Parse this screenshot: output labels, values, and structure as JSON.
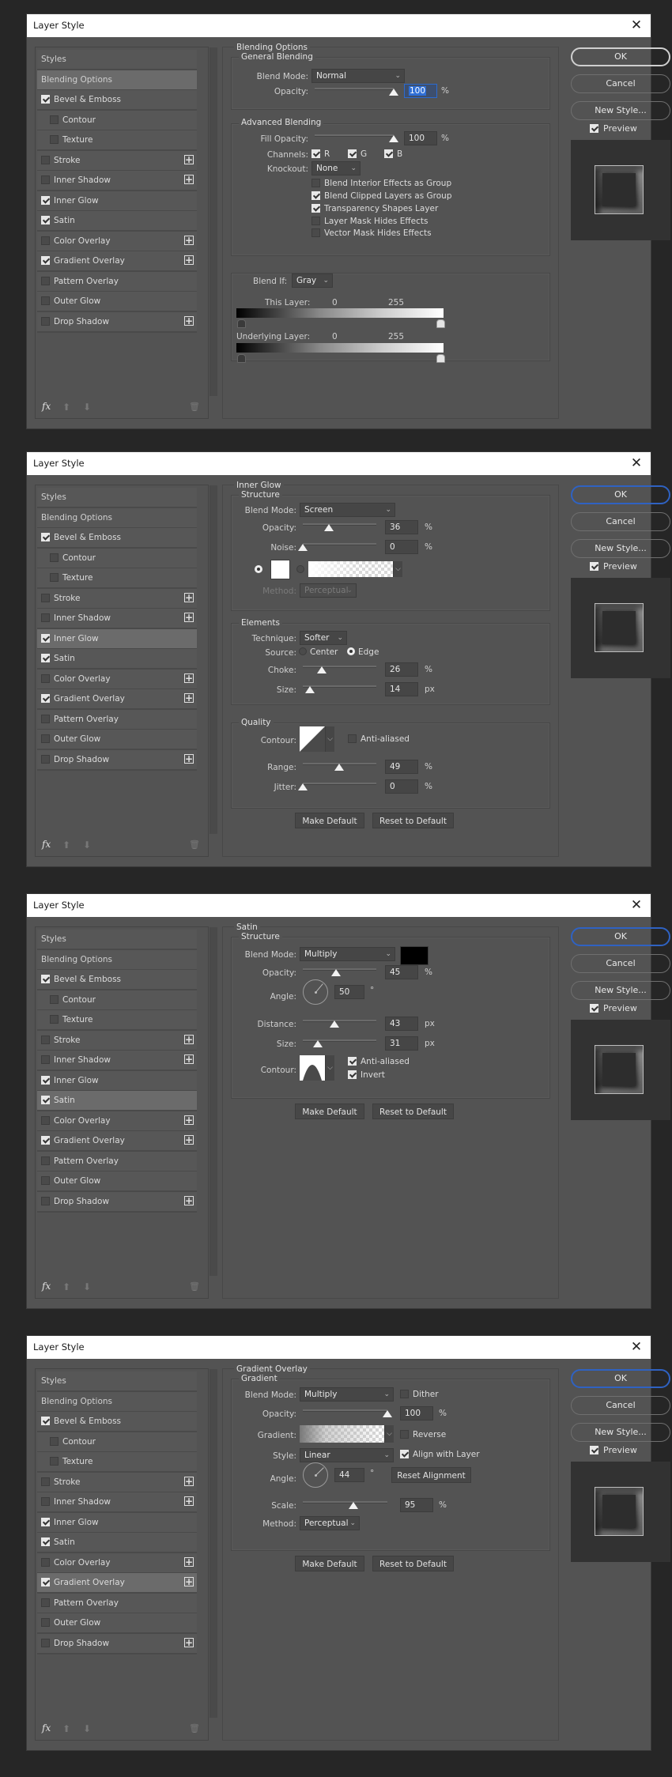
{
  "window_title": "Layer Style",
  "common": {
    "close_icon": "close-icon",
    "sidebar": {
      "styles_label": "Styles",
      "blending_options_label": "Blending Options",
      "items": [
        {
          "label": "Bevel & Emboss",
          "checked": true,
          "sub": false,
          "plus": false
        },
        {
          "label": "Contour",
          "checked": false,
          "sub": true,
          "plus": false
        },
        {
          "label": "Texture",
          "checked": false,
          "sub": true,
          "plus": false
        },
        {
          "label": "Stroke",
          "checked": false,
          "sub": false,
          "plus": true
        },
        {
          "label": "Inner Shadow",
          "checked": false,
          "sub": false,
          "plus": true
        },
        {
          "label": "Inner Glow",
          "checked": true,
          "sub": false,
          "plus": false
        },
        {
          "label": "Satin",
          "checked": true,
          "sub": false,
          "plus": false
        },
        {
          "label": "Color Overlay",
          "checked": false,
          "sub": false,
          "plus": true
        },
        {
          "label": "Gradient Overlay",
          "checked": true,
          "sub": false,
          "plus": true
        },
        {
          "label": "Pattern Overlay",
          "checked": false,
          "sub": false,
          "plus": false
        },
        {
          "label": "Outer Glow",
          "checked": false,
          "sub": false,
          "plus": false
        },
        {
          "label": "Drop Shadow",
          "checked": false,
          "sub": false,
          "plus": true
        }
      ],
      "footer": {
        "fx": "fx",
        "up_icon": "move-up-icon",
        "down_icon": "move-down-icon",
        "trash_icon": "trash-icon"
      }
    },
    "buttons": {
      "ok": "OK",
      "cancel": "Cancel",
      "new_style": "New Style...",
      "preview": "Preview",
      "preview_checked": true
    },
    "make_default": "Make Default",
    "reset_to_default": "Reset to Default"
  },
  "dialogs": [
    {
      "active_item": "Blending Options",
      "panel": {
        "title": "Blending Options",
        "general": {
          "title": "General Blending",
          "blend_mode_label": "Blend Mode:",
          "blend_mode": "Normal",
          "opacity_label": "Opacity:",
          "opacity": "100",
          "opacity_unit": "%",
          "opacity_fraction": 1.0
        },
        "advanced": {
          "title": "Advanced Blending",
          "fill_opacity_label": "Fill Opacity:",
          "fill_opacity": "100",
          "fill_unit": "%",
          "fill_fraction": 1.0,
          "channels_label": "Channels:",
          "channels": [
            {
              "label": "R",
              "checked": true
            },
            {
              "label": "G",
              "checked": true
            },
            {
              "label": "B",
              "checked": true
            }
          ],
          "knockout_label": "Knockout:",
          "knockout": "None",
          "options": [
            {
              "label": "Blend Interior Effects as Group",
              "checked": false
            },
            {
              "label": "Blend Clipped Layers as Group",
              "checked": true
            },
            {
              "label": "Transparency Shapes Layer",
              "checked": true
            },
            {
              "label": "Layer Mask Hides Effects",
              "checked": false
            },
            {
              "label": "Vector Mask Hides Effects",
              "checked": false
            }
          ]
        },
        "blend_if": {
          "label": "Blend If:",
          "value": "Gray",
          "this_layer_label": "This Layer:",
          "this_low": "0",
          "this_high": "255",
          "underlying_label": "Underlying Layer:",
          "under_low": "0",
          "under_high": "255"
        }
      }
    },
    {
      "active_item": "Inner Glow",
      "panel": {
        "title": "Inner Glow",
        "structure": {
          "title": "Structure",
          "blend_mode_label": "Blend Mode:",
          "blend_mode": "Screen",
          "opacity_label": "Opacity:",
          "opacity": "36",
          "opacity_unit": "%",
          "opacity_fraction": 0.36,
          "noise_label": "Noise:",
          "noise": "0",
          "noise_unit": "%",
          "noise_fraction": 0.0,
          "color_mode": "solid",
          "color": "#ffffff",
          "method_label": "Method:",
          "method": "Perceptual"
        },
        "elements": {
          "title": "Elements",
          "technique_label": "Technique:",
          "technique": "Softer",
          "source_label": "Source:",
          "source_center": "Center",
          "source_edge": "Edge",
          "source_selected": "Edge",
          "choke_label": "Choke:",
          "choke": "26",
          "choke_unit": "%",
          "choke_fraction": 0.26,
          "size_label": "Size:",
          "size": "14",
          "size_unit": "px",
          "size_fraction": 0.1
        },
        "quality": {
          "title": "Quality",
          "contour_label": "Contour:",
          "anti_aliased": "Anti-aliased",
          "anti_aliased_checked": false,
          "range_label": "Range:",
          "range": "49",
          "range_unit": "%",
          "range_fraction": 0.49,
          "jitter_label": "Jitter:",
          "jitter": "0",
          "jitter_unit": "%",
          "jitter_fraction": 0.0
        }
      }
    },
    {
      "active_item": "Satin",
      "panel": {
        "title": "Satin",
        "structure": {
          "title": "Structure",
          "blend_mode_label": "Blend Mode:",
          "blend_mode": "Multiply",
          "color": "#000000",
          "opacity_label": "Opacity:",
          "opacity": "45",
          "opacity_unit": "%",
          "opacity_fraction": 0.45,
          "angle_label": "Angle:",
          "angle": "50",
          "angle_unit": "°",
          "distance_label": "Distance:",
          "distance": "43",
          "distance_unit": "px",
          "distance_fraction": 0.43,
          "size_label": "Size:",
          "size": "31",
          "size_unit": "px",
          "size_fraction": 0.2,
          "contour_label": "Contour:",
          "anti_aliased": "Anti-aliased",
          "anti_aliased_checked": true,
          "invert": "Invert",
          "invert_checked": true
        }
      }
    },
    {
      "active_item": "Gradient Overlay",
      "panel": {
        "title": "Gradient Overlay",
        "gradient": {
          "title": "Gradient",
          "blend_mode_label": "Blend Mode:",
          "blend_mode": "Multiply",
          "dither": "Dither",
          "dither_checked": false,
          "opacity_label": "Opacity:",
          "opacity": "100",
          "opacity_unit": "%",
          "opacity_fraction": 1.0,
          "gradient_label": "Gradient:",
          "reverse": "Reverse",
          "reverse_checked": false,
          "style_label": "Style:",
          "style": "Linear",
          "align": "Align with Layer",
          "align_checked": true,
          "angle_label": "Angle:",
          "angle": "44",
          "angle_unit": "°",
          "reset_alignment": "Reset Alignment",
          "scale_label": "Scale:",
          "scale": "95",
          "scale_unit": "%",
          "scale_fraction": 0.6,
          "method_label": "Method:",
          "method": "Perceptual"
        }
      }
    }
  ]
}
